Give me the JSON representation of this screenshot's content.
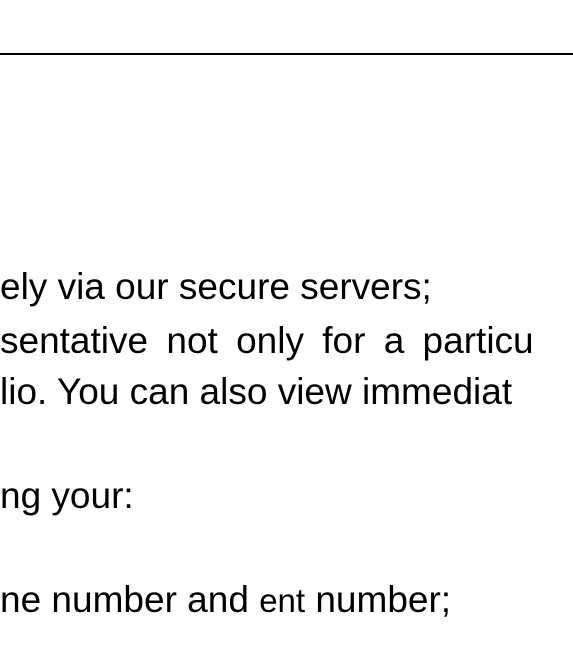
{
  "document": {
    "lines": [
      "ely via our secure servers;",
      "sentative not only for a particu",
      "lio. You can also view immediat",
      "ng your:"
    ],
    "line5": {
      "part1": "ne number and ",
      "part2": "ent",
      "part3": " number;"
    }
  }
}
